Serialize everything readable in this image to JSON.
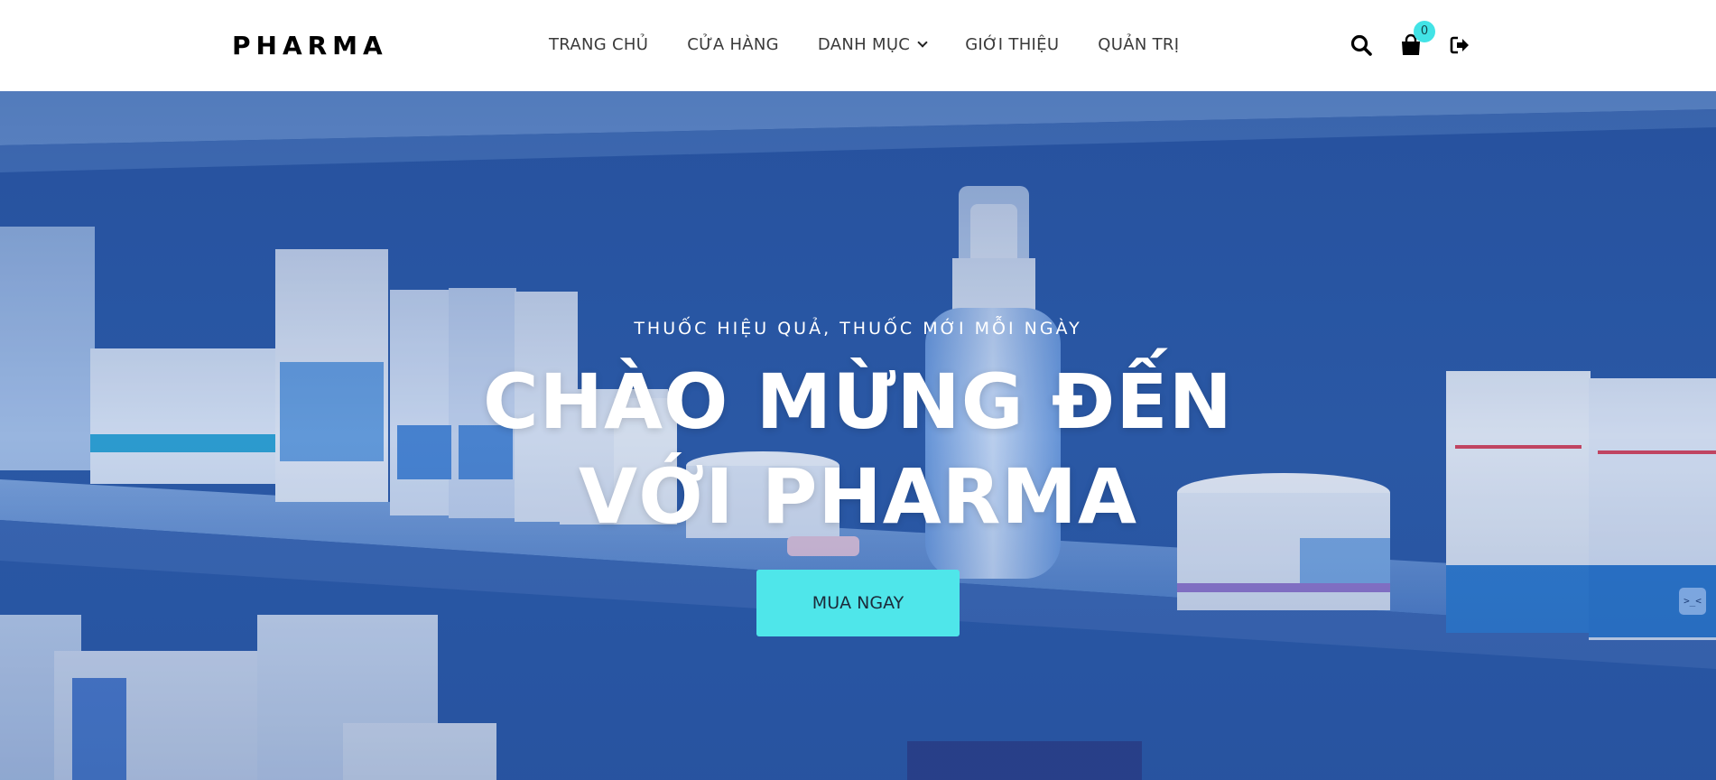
{
  "brand": {
    "logo": "PHARMA"
  },
  "nav": {
    "items": [
      {
        "label": "TRANG CHỦ"
      },
      {
        "label": "CỬA HÀNG"
      },
      {
        "label": "DANH MỤC",
        "has_dropdown": true
      },
      {
        "label": "GIỚI THIỆU"
      },
      {
        "label": "QUẢN TRỊ"
      }
    ]
  },
  "header_icons": {
    "search": "search-icon",
    "cart": "shopping-bag-icon",
    "cart_count": "0",
    "logout": "sign-out-icon"
  },
  "hero": {
    "subtitle": "THUỐC HIỆU QUẢ, THUỐC MỚI MỖI NGÀY",
    "title_line1": "CHÀO MỪNG ĐẾN",
    "title_line2": "VỚI PHARMA",
    "cta": "MUA NGAY",
    "background": "pharmacy-shelf-photo"
  },
  "side_tab": {
    "label": ">_<"
  },
  "colors": {
    "accent": "#4fe6ea",
    "hero_blue": "#2f5fae",
    "text_dark": "#3a3a3a"
  }
}
